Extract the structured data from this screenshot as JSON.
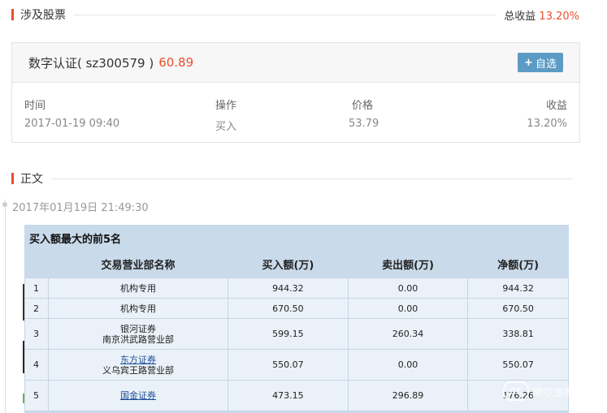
{
  "stocks_section": {
    "title": "涉及股票",
    "total_label": "总收益",
    "total_value": "13.20%"
  },
  "stock": {
    "name": "数字认证( sz300579 )",
    "price": "60.89",
    "add_button": "自选",
    "headers": [
      "时间",
      "操作",
      "价格",
      "收益"
    ],
    "row": [
      "2017-01-19 09:40",
      "买入",
      "53.79",
      "13.20%"
    ]
  },
  "body_section": {
    "title": "正文"
  },
  "timeline": {
    "time": "2017年01月19日  21:49:30"
  },
  "article": {
    "caption": "买入额最大的前5名",
    "columns": [
      "交易营业部名称",
      "买入额(万)",
      "卖出额(万)",
      "净额(万)"
    ],
    "rows": [
      {
        "idx": "1",
        "broker": "机构专用",
        "branch": "",
        "buy": "944.32",
        "sell": "0.00",
        "net": "944.32"
      },
      {
        "idx": "2",
        "broker": "机构专用",
        "branch": "",
        "buy": "670.50",
        "sell": "0.00",
        "net": "670.50"
      },
      {
        "idx": "3",
        "broker": "银河证券",
        "branch": "南京洪武路营业部",
        "buy": "599.15",
        "sell": "260.34",
        "net": "338.81"
      },
      {
        "idx": "4",
        "broker": "东方证券",
        "branch": "义乌宾王路营业部",
        "buy": "550.07",
        "sell": "0.00",
        "net": "550.07"
      },
      {
        "idx": "5",
        "broker": "国金证券",
        "branch": "",
        "buy": "473.15",
        "sell": "296.89",
        "net": "176.26"
      }
    ],
    "watermark": "摩尔金融"
  }
}
